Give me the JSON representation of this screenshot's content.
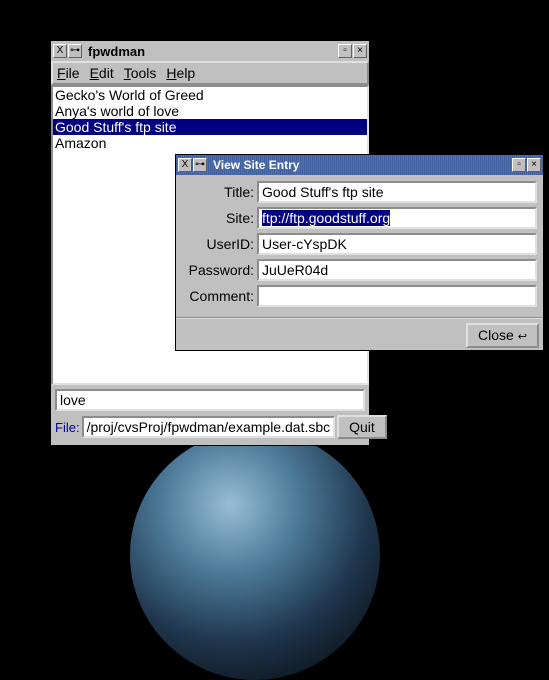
{
  "main": {
    "title": "fpwdman",
    "menu": {
      "file": "File",
      "edit": "Edit",
      "tools": "Tools",
      "help": "Help"
    },
    "list": [
      {
        "label": "Gecko's World of Greed",
        "selected": false
      },
      {
        "label": "Anya's world of love",
        "selected": false
      },
      {
        "label": "Good Stuff's ftp site",
        "selected": true
      },
      {
        "label": "Amazon",
        "selected": false
      }
    ],
    "search_value": "love",
    "file_label": "File:",
    "file_path": "/proj/cvsProj/fpwdman/example.dat.sbc",
    "quit_label": "Quit"
  },
  "dialog": {
    "title": "View Site Entry",
    "rows": {
      "title_label": "Title:",
      "title_value": "Good Stuff's ftp site",
      "site_label": "Site:",
      "site_value": "ftp://ftp.goodstuff.org",
      "userid_label": "UserID:",
      "userid_value": "User-cYspDK",
      "password_label": "Password:",
      "password_value": "JuUeR04d",
      "comment_label": "Comment:",
      "comment_value": ""
    },
    "close_label": "Close"
  }
}
